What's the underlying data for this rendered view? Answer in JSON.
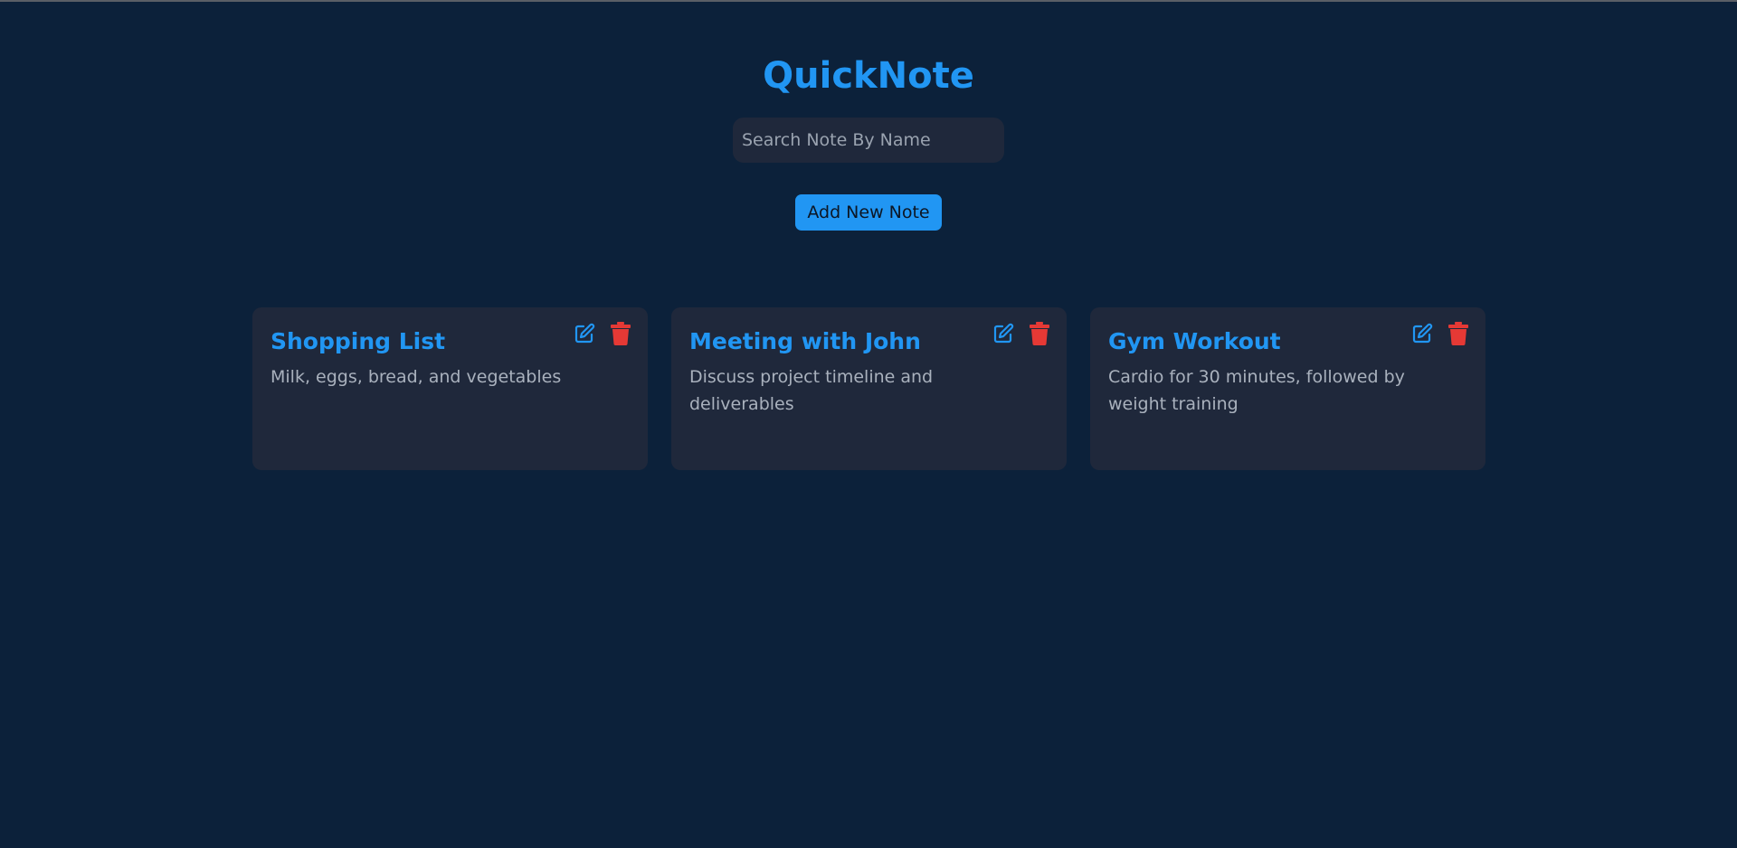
{
  "app": {
    "title": "QuickNote"
  },
  "search": {
    "placeholder": "Search Note By Name",
    "value": ""
  },
  "actions": {
    "add_label": "Add New Note"
  },
  "notes": [
    {
      "title": "Shopping List",
      "body": "Milk, eggs, bread, and vegetables",
      "icons": [
        "edit-icon",
        "trash-icon"
      ]
    },
    {
      "title": "Meeting with John",
      "body": "Discuss project timeline and deliverables",
      "icons": [
        "edit-icon",
        "trash-icon"
      ]
    },
    {
      "title": "Gym Workout",
      "body": "Cardio for 30 minutes, followed by weight training",
      "icons": [
        "edit-icon",
        "trash-icon"
      ]
    }
  ],
  "colors": {
    "background": "#0c213a",
    "card": "#1f283b",
    "accent": "#2196f3",
    "delete": "#e53935",
    "body_text": "#a9b1bd"
  }
}
